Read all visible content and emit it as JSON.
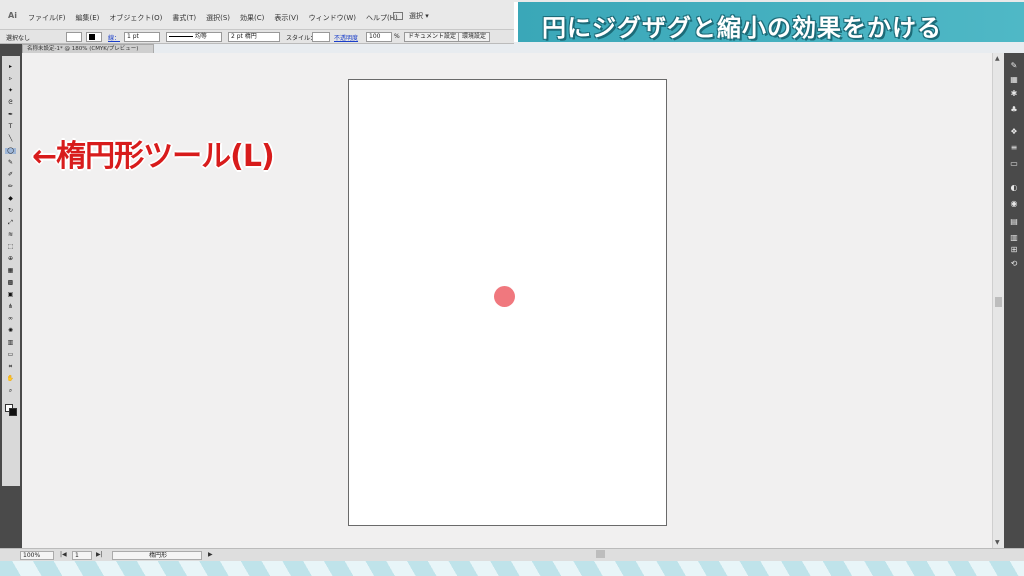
{
  "menubar": {
    "logo": "Ai",
    "items": [
      "ファイル(F)",
      "編集(E)",
      "オブジェクト(O)",
      "書式(T)",
      "選択(S)",
      "効果(C)",
      "表示(V)",
      "ウィンドウ(W)",
      "ヘルプ(H)"
    ],
    "workspace_label": "選択 ▾"
  },
  "banner": {
    "title": "円にジグザグと縮小の効果をかける",
    "bg_color": "#3aa7b8"
  },
  "controlbar": {
    "selection": "選択なし",
    "stroke_label": "線：",
    "stroke_width": "1 pt",
    "uniform": "均等",
    "brush": "2 pt 楕円",
    "style_label": "スタイル：",
    "opacity_label": "不透明度",
    "opacity_value": "100",
    "percent": "%",
    "doc_setup_button": "ドキュメント設定",
    "prefs_button": "環境設定"
  },
  "document": {
    "tab_title": "名称未設定-1* @ 180% (CMYK/プレビュー)"
  },
  "annotation": {
    "text": "←楕円形ツール(L)",
    "color": "#d81c1c"
  },
  "artboard": {
    "object": "circle",
    "fill_color": "#f0787e"
  },
  "status": {
    "zoom": "100%",
    "page": "1",
    "tool": "楕円形"
  },
  "toolbar": {
    "tools": [
      "selection-tool",
      "direct-selection-tool",
      "magic-wand-tool",
      "lasso-tool",
      "pen-tool",
      "type-tool",
      "line-tool",
      "ellipse-tool",
      "paintbrush-tool",
      "pencil-tool",
      "blob-brush-tool",
      "eraser-tool",
      "rotate-tool",
      "scale-tool",
      "width-tool",
      "free-transform-tool",
      "shape-builder-tool",
      "perspective-grid-tool",
      "mesh-tool",
      "gradient-tool",
      "eyedropper-tool",
      "blend-tool",
      "symbol-sprayer-tool",
      "column-graph-tool",
      "artboard-tool",
      "slice-tool",
      "hand-tool",
      "zoom-tool"
    ],
    "selected": "ellipse-tool"
  },
  "rightdock": {
    "icons": [
      "color-panel-icon",
      "swatches-panel-icon",
      "brushes-panel-icon",
      "symbols-panel-icon",
      "graphic-styles-icon",
      "stroke-panel-icon",
      "gradient-panel-icon",
      "transparency-panel-icon",
      "appearance-panel-icon",
      "layers-panel-icon",
      "artboards-panel-icon",
      "align-panel-icon",
      "transform-panel-icon"
    ]
  }
}
